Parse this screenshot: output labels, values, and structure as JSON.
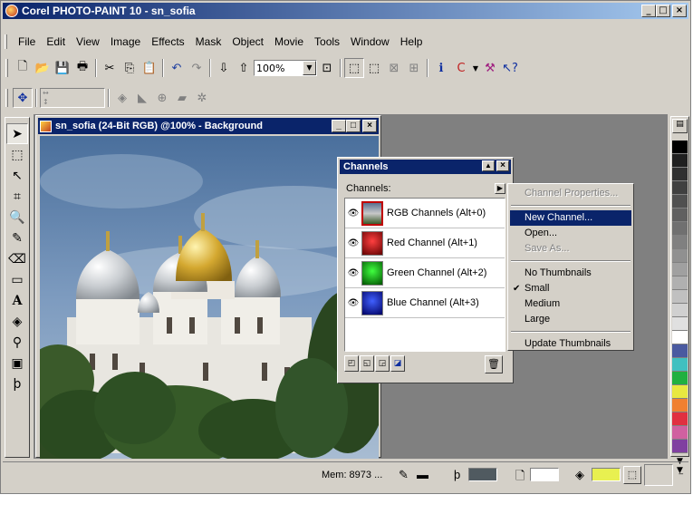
{
  "app": {
    "title": "Corel PHOTO-PAINT 10 - sn_sofia",
    "window_buttons": [
      "_",
      "□",
      "×"
    ]
  },
  "menu": [
    "File",
    "Edit",
    "View",
    "Image",
    "Effects",
    "Mask",
    "Object",
    "Movie",
    "Tools",
    "Window",
    "Help"
  ],
  "toolbar": {
    "zoom_value": "100%"
  },
  "document": {
    "title": "sn_sofia (24-Bit RGB) @100% - Background"
  },
  "channels_panel": {
    "title": "Channels",
    "label": "Channels:",
    "rows": [
      {
        "name": "RGB Channels  (Alt+0)",
        "thumb_color": "#3a4a5a"
      },
      {
        "name": "Red Channel  (Alt+1)",
        "thumb_color": "#b00000"
      },
      {
        "name": "Green Channel  (Alt+2)",
        "thumb_color": "#00a000"
      },
      {
        "name": "Blue Channel  (Alt+3)",
        "thumb_color": "#0000b0"
      }
    ]
  },
  "context_menu": {
    "items": [
      {
        "label": "Channel Properties...",
        "state": "disabled"
      },
      {
        "label": "New Channel...",
        "state": "highlighted"
      },
      {
        "label": "Open...",
        "state": "normal"
      },
      {
        "label": "Save As...",
        "state": "disabled"
      },
      {
        "label": "No Thumbnails",
        "state": "normal"
      },
      {
        "label": "Small",
        "state": "checked"
      },
      {
        "label": "Medium",
        "state": "normal"
      },
      {
        "label": "Large",
        "state": "normal"
      },
      {
        "label": "Update Thumbnails",
        "state": "normal"
      }
    ]
  },
  "palette": {
    "colors": [
      "#000000",
      "#202020",
      "#303030",
      "#404040",
      "#505050",
      "#606060",
      "#707070",
      "#808080",
      "#909090",
      "#a0a0a0",
      "#b0b0b0",
      "#c0c0c0",
      "#d0d0d0",
      "#e0e0e0",
      "#ffffff",
      "#4a5aa0",
      "#40c0c0",
      "#20b040",
      "#e8e840",
      "#f08030",
      "#e03040",
      "#d060a0",
      "#8040a0"
    ]
  },
  "status": {
    "memory": "Mem: 8973 ...",
    "fill_color": "#e8f050",
    "paper_color": "#ffffff",
    "outline_color": "#505a60"
  }
}
